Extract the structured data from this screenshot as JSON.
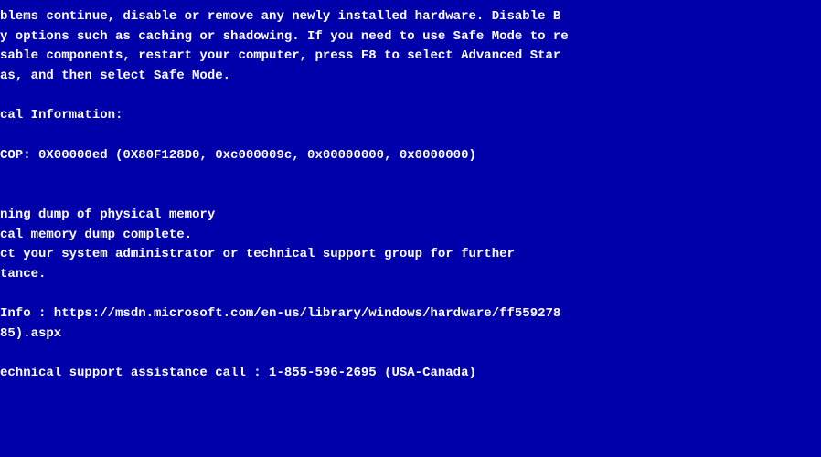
{
  "bsod": {
    "background_color": "#0000AA",
    "text_color": "#FFFFFF",
    "lines": [
      "blems continue, disable or remove any newly installed hardware. Disable B",
      "y options such as caching or shadowing. If you need to use Safe Mode to re",
      "sable components, restart your computer, press F8 to select Advanced Star",
      "as, and then select Safe Mode.",
      "",
      "cal Information:",
      "",
      "COP: 0X00000ed (0X80F128D0, 0xc000009c, 0x00000000, 0x0000000)",
      "",
      "",
      "ning dump of physical memory",
      "cal memory dump complete.",
      "ct your system administrator or technical support group for further",
      "tance.",
      "",
      "Info : https://msdn.microsoft.com/en-us/library/windows/hardware/ff559278",
      "85).aspx",
      "",
      "echnical support assistance call : 1-855-596-2695 (USA-Canada)"
    ]
  }
}
